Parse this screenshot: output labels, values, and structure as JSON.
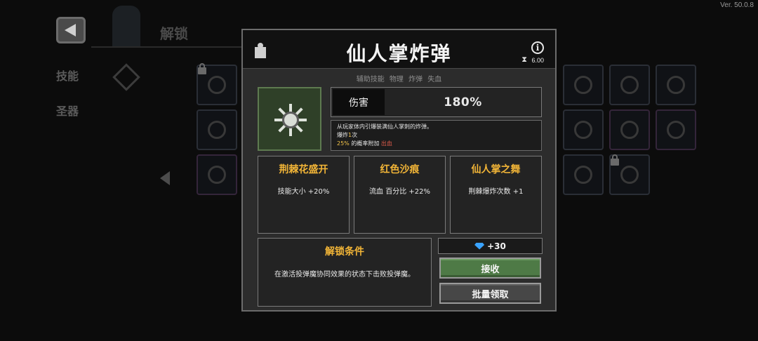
{
  "version": "Ver. 50.0.8",
  "screen": {
    "title": "解锁",
    "tabs": [
      "技能",
      "圣器"
    ]
  },
  "dialog": {
    "title": "仙人掌炸弹",
    "cooldown": "6.00",
    "tags": [
      "辅助技能",
      "物理",
      "炸弹",
      "失血"
    ],
    "damage": {
      "label": "伤害",
      "value": "180%"
    },
    "description": {
      "line1": "从玩家体内引爆装满仙人掌刺的炸弹。",
      "line2_prefix": "爆炸",
      "line2_num": "1",
      "line2_suffix": "次",
      "line3_num": "25%",
      "line3_mid": " 的概率附加 ",
      "line3_effect": "出血"
    },
    "upgrades": [
      {
        "name": "荆棘花盛开",
        "stat": "技能大小 +20%"
      },
      {
        "name": "红色沙痕",
        "stat": "流血 百分比 +22%"
      },
      {
        "name": "仙人掌之舞",
        "stat": "荆棘爆炸次数 +1"
      }
    ],
    "unlock_condition": {
      "title": "解锁条件",
      "text": "在激活投弹魔协同效果的状态下击败投弹魔。"
    },
    "reward": "+30",
    "buttons": {
      "accept": "接收",
      "bulk_claim": "批量领取"
    }
  }
}
